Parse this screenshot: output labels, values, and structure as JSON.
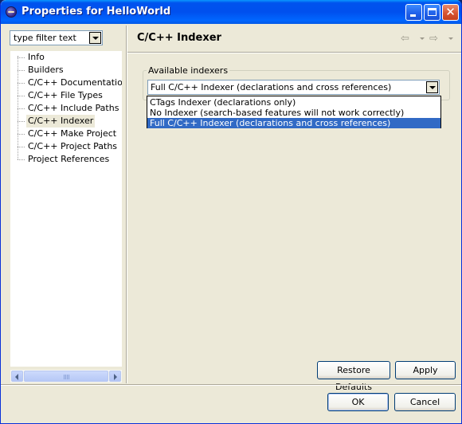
{
  "window": {
    "title": "Properties for HelloWorld",
    "minimize_icon": "minimize-icon",
    "maximize_icon": "maximize-icon",
    "close_icon": "close-icon"
  },
  "sidebar": {
    "filter_placeholder": "type filter text",
    "items": [
      {
        "label": "Info"
      },
      {
        "label": "Builders"
      },
      {
        "label": "C/C++ Documentation"
      },
      {
        "label": "C/C++ File Types"
      },
      {
        "label": "C/C++ Include Paths & Sy"
      },
      {
        "label": "C/C++ Indexer"
      },
      {
        "label": "C/C++ Make Project"
      },
      {
        "label": "C/C++ Project Paths"
      },
      {
        "label": "Project References"
      }
    ],
    "selected_index": 5,
    "scroll_thumb_glyph": "III"
  },
  "page": {
    "title": "C/C++ Indexer",
    "nav_back_glyph": "⇦",
    "nav_forward_glyph": "⇨"
  },
  "indexers": {
    "group_label": "Available indexers",
    "selected_value": "Full C/C++ Indexer (declarations and cross references)",
    "options": [
      "CTags Indexer (declarations only)",
      "No Indexer (search-based features will not work correctly)",
      "Full C/C++ Indexer (declarations and cross references)"
    ],
    "highlighted_index": 2
  },
  "buttons": {
    "restore_defaults": "Restore Defaults",
    "apply": "Apply",
    "ok": "OK",
    "cancel": "Cancel"
  },
  "colors": {
    "title_bar": "#0055e5",
    "selection": "#316ac5",
    "dialog_bg": "#ece9d8"
  }
}
